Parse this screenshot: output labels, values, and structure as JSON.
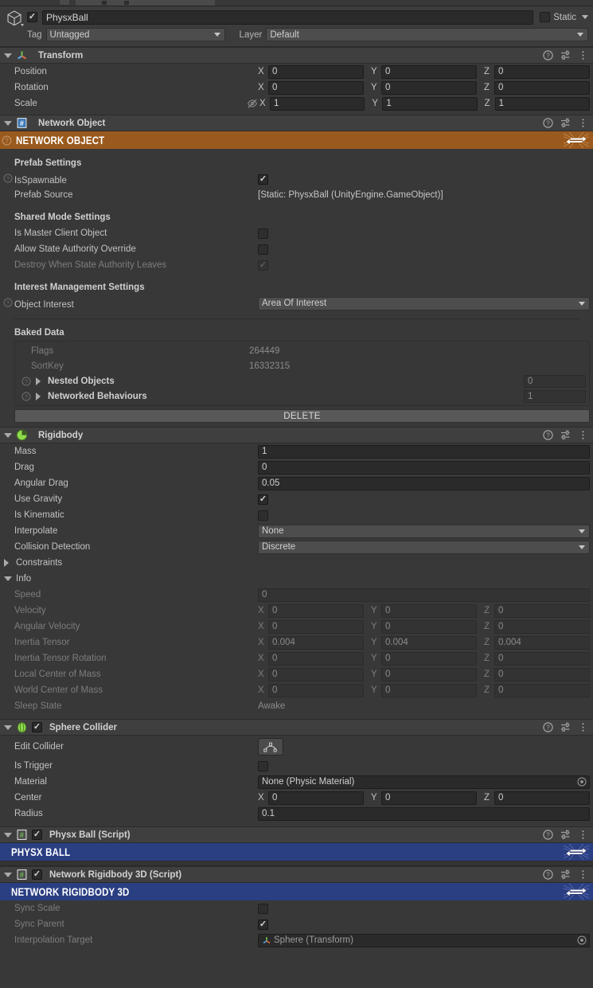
{
  "object_header": {
    "enabled": true,
    "name_value": "PhysxBall",
    "static_label": "Static",
    "static_checked": false,
    "tag_label": "Tag",
    "tag_value": "Untagged",
    "layer_label": "Layer",
    "layer_value": "Default"
  },
  "components": [
    {
      "id": "transform",
      "title": "Transform",
      "icon": "transform-axis-icon",
      "expanded": true,
      "rows": {
        "position": {
          "label": "Position",
          "x": "0",
          "y": "0",
          "z": "0"
        },
        "rotation": {
          "label": "Rotation",
          "x": "0",
          "y": "0",
          "z": "0"
        },
        "scale": {
          "label": "Scale",
          "x": "1",
          "y": "1",
          "z": "1"
        }
      }
    },
    {
      "id": "network-object",
      "title": "Network Object",
      "icon": "csharp-script-icon",
      "banner": {
        "text": "NETWORK OBJECT",
        "color": "#9a5a1d"
      },
      "prefab_settings_header": "Prefab Settings",
      "is_spawnable": {
        "label": "IsSpawnable",
        "checked": true
      },
      "prefab_source": {
        "label": "Prefab Source",
        "value": "[Static: PhysxBall (UnityEngine.GameObject)]"
      },
      "shared_mode_header": "Shared Mode Settings",
      "is_master_client_object": {
        "label": "Is Master Client Object",
        "checked": false
      },
      "allow_state_authority_override": {
        "label": "Allow State Authority Override",
        "checked": false
      },
      "destroy_when_state_authority_leaves": {
        "label": "Destroy When State Authority Leaves",
        "checked": true,
        "disabled": true
      },
      "interest_header": "Interest Management Settings",
      "object_interest": {
        "label": "Object Interest",
        "value": "Area Of Interest"
      },
      "baked_data_header": "Baked Data",
      "flags": {
        "label": "Flags",
        "value": "264449"
      },
      "sort_key": {
        "label": "SortKey",
        "value": "16332315"
      },
      "nested_objects": {
        "label": "Nested Objects",
        "value": "0"
      },
      "networked_behaviours": {
        "label": "Networked Behaviours",
        "value": "1"
      },
      "delete_button": "DELETE"
    },
    {
      "id": "rigidbody",
      "title": "Rigidbody",
      "icon": "rigidbody-icon",
      "mass": {
        "label": "Mass",
        "value": "1"
      },
      "drag": {
        "label": "Drag",
        "value": "0"
      },
      "angular_drag": {
        "label": "Angular Drag",
        "value": "0.05"
      },
      "use_gravity": {
        "label": "Use Gravity",
        "checked": true
      },
      "is_kinematic": {
        "label": "Is Kinematic",
        "checked": false
      },
      "interpolate": {
        "label": "Interpolate",
        "value": "None"
      },
      "collision_detection": {
        "label": "Collision Detection",
        "value": "Discrete"
      },
      "constraints": {
        "label": "Constraints",
        "expanded": false
      },
      "info": {
        "label": "Info",
        "expanded": true
      },
      "speed": {
        "label": "Speed",
        "value": "0"
      },
      "velocity": {
        "label": "Velocity",
        "x": "0",
        "y": "0",
        "z": "0"
      },
      "angular_velocity": {
        "label": "Angular Velocity",
        "x": "0",
        "y": "0",
        "z": "0"
      },
      "inertia_tensor": {
        "label": "Inertia Tensor",
        "x": "0.004",
        "y": "0.004",
        "z": "0.004"
      },
      "inertia_tensor_rotation": {
        "label": "Inertia Tensor Rotation",
        "x": "0",
        "y": "0",
        "z": "0"
      },
      "local_center_of_mass": {
        "label": "Local Center of Mass",
        "x": "0",
        "y": "0",
        "z": "0"
      },
      "world_center_of_mass": {
        "label": "World Center of Mass",
        "x": "0",
        "y": "0",
        "z": "0"
      },
      "sleep_state": {
        "label": "Sleep State",
        "value": "Awake"
      }
    },
    {
      "id": "sphere-collider",
      "title": "Sphere Collider",
      "icon": "sphere-collider-icon",
      "enabled": true,
      "edit_collider": {
        "label": "Edit Collider"
      },
      "is_trigger": {
        "label": "Is Trigger",
        "checked": false
      },
      "material": {
        "label": "Material",
        "value": "None (Physic Material)"
      },
      "center": {
        "label": "Center",
        "x": "0",
        "y": "0",
        "z": "0"
      },
      "radius": {
        "label": "Radius",
        "value": "0.1"
      }
    },
    {
      "id": "physx-ball-script",
      "title": "Physx Ball (Script)",
      "icon": "csharp-script-icon",
      "enabled": true,
      "banner": {
        "text": "PHYSX BALL",
        "color": "#2a3e82"
      }
    },
    {
      "id": "network-rigidbody-3d-script",
      "title": "Network Rigidbody 3D (Script)",
      "icon": "csharp-script-icon",
      "enabled": true,
      "banner": {
        "text": "NETWORK RIGIDBODY 3D",
        "color": "#2a3e82"
      },
      "sync_scale": {
        "label": "Sync Scale",
        "checked": false
      },
      "sync_parent": {
        "label": "Sync Parent",
        "checked": true
      },
      "interpolation_target": {
        "label": "Interpolation Target",
        "value": "Sphere (Transform)"
      }
    }
  ],
  "axes": {
    "x": "X",
    "y": "Y",
    "z": "Z"
  },
  "colors": {
    "background": "#383838",
    "header": "#3f3f3f",
    "field": "#2a2a2a",
    "fusion_orange": "#9a5a1d",
    "fusion_blue": "#2a3e82",
    "text": "#c2c2c2",
    "text_dim": "#7d7d7d"
  }
}
